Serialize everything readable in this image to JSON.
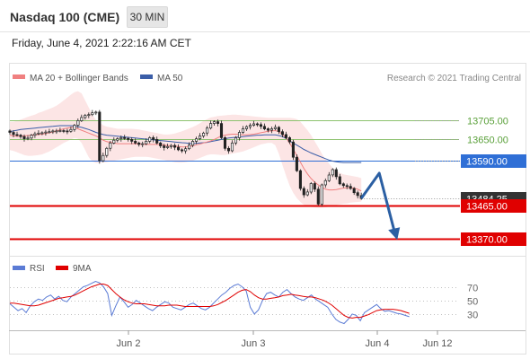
{
  "header": {
    "title": "Nasdaq 100 (CME)",
    "timeframe_label": "30 MIN",
    "timestamp": "Friday, June 4, 2021 2:22:16 AM CET"
  },
  "legend": {
    "items": [
      {
        "label": "MA 20 + Bollinger Bands",
        "color": "#f08080"
      },
      {
        "label": "MA 50",
        "color": "#3b5ea8"
      }
    ]
  },
  "copyright": "Research © 2021 Trading Central",
  "rsi_legend": {
    "items": [
      {
        "label": "RSI",
        "color": "#5b7bd5"
      },
      {
        "label": "9MA",
        "color": "#e00000"
      }
    ]
  },
  "colors": {
    "resistance": "#8dc26f",
    "pivot": "#2f6fd6",
    "support": "#e00000",
    "current": "#333333",
    "arrow": "#2b5fa3",
    "band_fill": "#fbdcdc"
  },
  "chart_data": [
    {
      "type": "candlestick",
      "price_range": [
        13330,
        13790
      ],
      "levels": [
        {
          "value": 13705,
          "label": "13705.00",
          "kind": "resistance"
        },
        {
          "value": 13650,
          "label": "13650.00",
          "kind": "resistance"
        },
        {
          "value": 13590,
          "label": "13590.00",
          "kind": "pivot"
        },
        {
          "value": 13484.25,
          "label": "13484.25",
          "kind": "current"
        },
        {
          "value": 13465,
          "label": "13465.00",
          "kind": "support"
        },
        {
          "value": 13370,
          "label": "13370.00",
          "kind": "support"
        }
      ],
      "x_ticks": [
        "Jun 2",
        "Jun 3",
        "Jun 4",
        "Jun 12"
      ],
      "close_series": [
        13670,
        13664,
        13662,
        13658,
        13652,
        13654,
        13662,
        13666,
        13668,
        13669,
        13671,
        13672,
        13674,
        13674,
        13675,
        13674,
        13673,
        13678,
        13690,
        13703,
        13712,
        13718,
        13720,
        13725,
        13727,
        13590,
        13605,
        13625,
        13640,
        13648,
        13652,
        13655,
        13653,
        13650,
        13645,
        13640,
        13636,
        13638,
        13645,
        13655,
        13650,
        13640,
        13632,
        13627,
        13630,
        13633,
        13628,
        13621,
        13618,
        13624,
        13634,
        13645,
        13652,
        13660,
        13668,
        13682,
        13695,
        13700,
        13695,
        13655,
        13625,
        13618,
        13640,
        13655,
        13670,
        13680,
        13686,
        13690,
        13694,
        13692,
        13687,
        13680,
        13676,
        13680,
        13684,
        13672,
        13664,
        13655,
        13643,
        13600,
        13562,
        13512,
        13494,
        13502,
        13526,
        13510,
        13468,
        13522,
        13534,
        13550,
        13565,
        13545,
        13525,
        13520,
        13518,
        13512,
        13500,
        13492,
        13484
      ],
      "ma20": [
        13662,
        13660,
        13659,
        13659,
        13660,
        13661,
        13662,
        13663,
        13664,
        13665,
        13667,
        13669,
        13671,
        13674,
        13677,
        13680,
        13682,
        13684,
        13684,
        13680,
        13676,
        13672,
        13668,
        13664,
        13660,
        13655,
        13648,
        13644,
        13642,
        13640,
        13638,
        13638,
        13638,
        13638,
        13638,
        13638,
        13637,
        13636,
        13636,
        13636,
        13636,
        13636,
        13635,
        13634,
        13633,
        13632,
        13631,
        13630,
        13629,
        13629,
        13630,
        13632,
        13635,
        13637,
        13640,
        13643,
        13646,
        13650,
        13655,
        13660,
        13662,
        13664,
        13665,
        13665,
        13664,
        13663,
        13663,
        13664,
        13665,
        13667,
        13669,
        13671,
        13673,
        13674,
        13675,
        13672,
        13665,
        13655,
        13640,
        13623,
        13605,
        13586,
        13568,
        13553,
        13540,
        13530,
        13522,
        13515,
        13510,
        13508,
        13508,
        13509,
        13511,
        13513,
        13514,
        13514,
        13513,
        13510,
        13505
      ],
      "bb_upper": [
        13700,
        13700,
        13702,
        13706,
        13710,
        13714,
        13717,
        13720,
        13725,
        13728,
        13732,
        13736,
        13740,
        13745,
        13752,
        13760,
        13768,
        13776,
        13783,
        13786,
        13780,
        13760,
        13740,
        13720,
        13705,
        13698,
        13690,
        13686,
        13684,
        13682,
        13680,
        13680,
        13680,
        13680,
        13680,
        13679,
        13678,
        13676,
        13674,
        13672,
        13670,
        13668,
        13666,
        13664,
        13664,
        13665,
        13667,
        13670,
        13673,
        13677,
        13681,
        13685,
        13690,
        13696,
        13702,
        13707,
        13712,
        13714,
        13716,
        13717,
        13718,
        13719,
        13720,
        13720,
        13719,
        13718,
        13717,
        13716,
        13715,
        13714,
        13713,
        13712,
        13711,
        13711,
        13711,
        13711,
        13711,
        13711,
        13711,
        13710,
        13707,
        13700,
        13688,
        13676,
        13662,
        13645,
        13628,
        13610,
        13595,
        13582,
        13570,
        13562,
        13556,
        13552,
        13550,
        13548,
        13546,
        13544,
        13541
      ],
      "bb_lower": [
        13620,
        13618,
        13614,
        13610,
        13606,
        13604,
        13604,
        13605,
        13606,
        13608,
        13612,
        13616,
        13622,
        13628,
        13634,
        13640,
        13645,
        13650,
        13654,
        13652,
        13640,
        13620,
        13600,
        13588,
        13584,
        13584,
        13585,
        13586,
        13588,
        13590,
        13592,
        13594,
        13596,
        13598,
        13600,
        13601,
        13601,
        13601,
        13601,
        13600,
        13598,
        13596,
        13594,
        13592,
        13590,
        13588,
        13586,
        13585,
        13585,
        13586,
        13588,
        13590,
        13594,
        13598,
        13602,
        13606,
        13608,
        13608,
        13607,
        13606,
        13606,
        13608,
        13610,
        13612,
        13614,
        13616,
        13620,
        13624,
        13628,
        13632,
        13636,
        13638,
        13640,
        13640,
        13634,
        13610,
        13578,
        13548,
        13520,
        13500,
        13485,
        13474,
        13466,
        13462,
        13460,
        13459,
        13458,
        13458,
        13459,
        13461,
        13463,
        13465,
        13467,
        13469,
        13470,
        13472,
        13473,
        13474,
        13475
      ],
      "ma50": [
        13672,
        13674,
        13676,
        13678,
        13679,
        13680,
        13681,
        13682,
        13683,
        13684,
        13685,
        13686,
        13687,
        13688,
        13689,
        13689,
        13689,
        13689,
        13688,
        13686,
        13684,
        13681,
        13678,
        13674,
        13670,
        13667,
        13664,
        13662,
        13661,
        13660,
        13659,
        13658,
        13657,
        13656,
        13655,
        13654,
        13653,
        13652,
        13651,
        13650,
        13649,
        13648,
        13647,
        13646,
        13645,
        13644,
        13643,
        13642,
        13641,
        13640,
        13639,
        13639,
        13639,
        13640,
        13641,
        13642,
        13644,
        13646,
        13648,
        13650,
        13652,
        13654,
        13655,
        13656,
        13657,
        13658,
        13659,
        13660,
        13661,
        13662,
        13662,
        13663,
        13663,
        13663,
        13663,
        13661,
        13658,
        13653,
        13646,
        13640,
        13634,
        13628,
        13622,
        13617,
        13612,
        13608,
        13604,
        13600,
        13596,
        13592,
        13589,
        13587,
        13586,
        13585,
        13585,
        13585,
        13585,
        13585,
        13585
      ],
      "forecast": [
        13484.25,
        13555,
        13370
      ],
      "x_range": [
        0,
        125
      ]
    },
    {
      "type": "line",
      "title": "RSI",
      "series": [
        {
          "name": "RSI",
          "color": "#5b7bd5"
        },
        {
          "name": "9MA",
          "color": "#e00000"
        }
      ],
      "ylim": [
        10,
        80
      ],
      "y_ticks": [
        70,
        50,
        30
      ],
      "rsi": [
        45,
        40,
        35,
        38,
        32,
        42,
        48,
        52,
        50,
        55,
        58,
        52,
        56,
        50,
        48,
        55,
        60,
        65,
        70,
        72,
        75,
        78,
        76,
        70,
        60,
        28,
        42,
        55,
        48,
        40,
        44,
        50,
        46,
        42,
        38,
        35,
        40,
        44,
        48,
        46,
        40,
        38,
        36,
        40,
        44,
        46,
        42,
        38,
        36,
        40,
        46,
        52,
        58,
        62,
        68,
        72,
        74,
        70,
        64,
        40,
        30,
        36,
        50,
        60,
        62,
        58,
        55,
        62,
        66,
        60,
        55,
        52,
        50,
        54,
        58,
        52,
        48,
        44,
        40,
        30,
        22,
        18,
        16,
        22,
        30,
        28,
        20,
        32,
        36,
        40,
        44,
        38,
        34,
        35,
        33,
        31,
        30,
        28,
        26
      ],
      "ma9": [
        46,
        46,
        45,
        44,
        43,
        42,
        42,
        43,
        45,
        47,
        49,
        51,
        53,
        54,
        55,
        56,
        58,
        61,
        64,
        67,
        70,
        72,
        74,
        74,
        72,
        66,
        60,
        55,
        51,
        48,
        46,
        45,
        45,
        45,
        44,
        43,
        42,
        42,
        42,
        43,
        43,
        43,
        42,
        41,
        41,
        41,
        41,
        41,
        41,
        41,
        42,
        44,
        47,
        50,
        54,
        58,
        62,
        65,
        66,
        63,
        58,
        54,
        52,
        52,
        53,
        54,
        55,
        57,
        58,
        59,
        58,
        57,
        56,
        55,
        55,
        54,
        52,
        50,
        47,
        43,
        38,
        33,
        28,
        25,
        24,
        25,
        25,
        27,
        29,
        32,
        35,
        36,
        37,
        37,
        37,
        36,
        35,
        33,
        31
      ]
    }
  ]
}
